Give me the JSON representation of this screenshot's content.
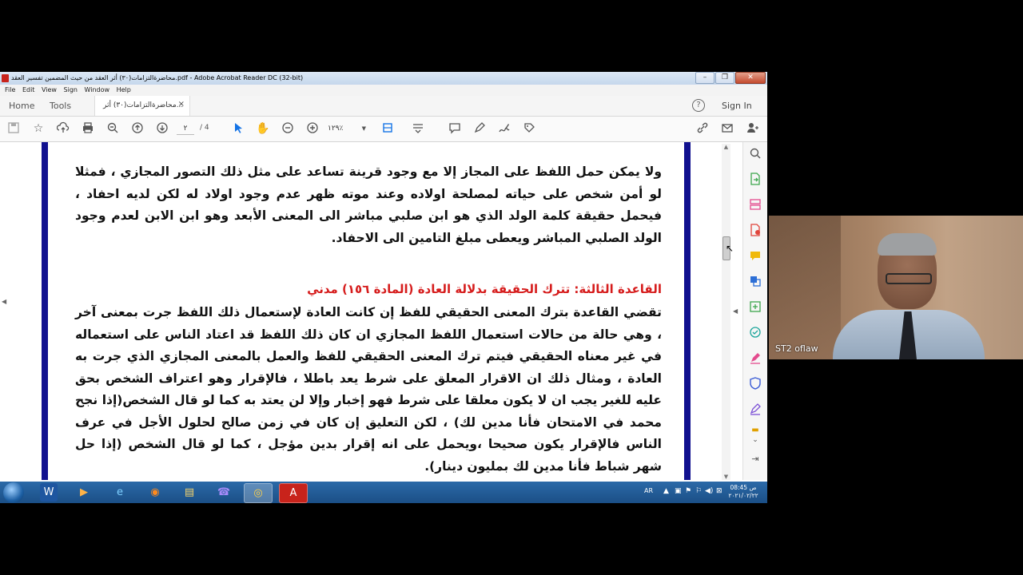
{
  "window": {
    "title": "محاضرةالتزامات(٣٠) أثر العقد من حيث المضمين تفسير العقد.pdf - Adobe Acrobat Reader DC (32-bit)",
    "controls": [
      "–",
      "❐",
      "✕"
    ]
  },
  "menu": [
    "File",
    "Edit",
    "View",
    "Sign",
    "Window",
    "Help"
  ],
  "tabs": {
    "home": "Home",
    "tools": "Tools",
    "document": "محاضرةالتزامات(٣٠) أثر...",
    "close": "×",
    "help": "?",
    "sign_in": "Sign In"
  },
  "toolbar": {
    "page_current": "٢",
    "page_total": "/ 4",
    "zoom": "١٢٩٪"
  },
  "document": {
    "paragraph1": "ولا يمكن حمل اللفظ على المجاز إلا مع وجود قرينة تساعد على مثل ذلك التصور المجازي ، فمثلا لو أمن شخص على حياته لمصلحة اولاده وعند موته ظهر عدم وجود اولاد له لكن لديه احفاد ، فيحمل حقيقة كلمة الولد الذي هو ابن صلبي مباشر الى المعنى الأبعد وهو ابن الابن لعدم وجود الولد الصلبي المباشر ويعطى مبلغ التامين الى الاحفاد.",
    "heading": "القاعدة الثالثة: تترك الحقيقة بدلالة العادة (المادة ١٥٦) مدني",
    "paragraph2": "تقضي القاعدة بترك المعنى الحقيقي للفظ إن كانت العادة لإستعمال ذلك اللفظ جرت بمعنى آخر ، وهي حالة من حالات استعمال اللفظ المجازي ان كان ذلك اللفظ قد اعتاد الناس على استعماله في غير معناه الحقيقي فيتم ترك المعنى الحقيقي للفظ والعمل بالمعنى المجازي الذي جرت به العادة ، ومثال ذلك ان الاقرار المعلق على شرط يعد باطلا ، فالإقرار وهو اعتراف الشخص بحق عليه للغير يجب ان لا يكون معلقا على شرط فهو إخبار وإلا لن يعتد به كما لو قال الشخص(إذا نجح محمد في الامتحان فأنا مدين لك) ، لكن التعليق إن كان في زمن صالح لحلول الأجل في عرف الناس فالإقرار يكون صحيحا ،ويحمل على انه إقرار بدين مؤجل ، كما لو قال الشخص (إذا حل شهر شباط فأنا مدين لك بمليون دينار)."
  },
  "taskbar": {
    "apps": [
      "W",
      "▶",
      "e",
      "◉",
      "▤",
      "☎",
      "◎",
      "A"
    ],
    "language": "AR",
    "time": "08:45 ص",
    "date": "٢٠٢١/٠٢/٢٢"
  },
  "webcam": {
    "name": "ST2 oflaw"
  },
  "colors": {
    "border_blue": "#11118f",
    "heading_red": "#d61d1d",
    "acrobat_red": "#c8231b",
    "taskbar": "#1b4f86"
  },
  "icons": {
    "toolbar": [
      "save-icon",
      "star-icon",
      "upload-icon",
      "print-icon",
      "zoom-out-search-icon",
      "page-up-icon",
      "page-down-icon",
      "select-cursor-icon",
      "hand-icon",
      "zoom-minus-icon",
      "zoom-plus-icon",
      "fit-page-icon",
      "scroll-mode-icon",
      "comment-icon",
      "pen-icon",
      "sign-icon",
      "stamp-icon",
      "link-icon",
      "email-icon",
      "share-user-icon"
    ],
    "right_pane": [
      "search-icon",
      "export-pdf-icon",
      "organize-icon",
      "create-pdf-icon",
      "comment-icon",
      "combine-icon",
      "edit-pdf-icon",
      "fill-sign-icon",
      "highlight-icon",
      "protect-icon",
      "signature-icon",
      "more-tools-icon",
      "expand-icon"
    ]
  }
}
